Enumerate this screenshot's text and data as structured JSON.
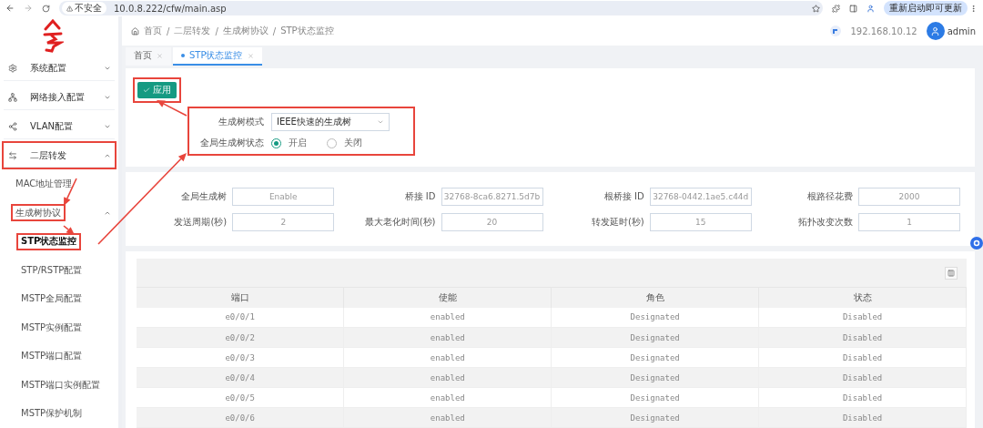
{
  "browser": {
    "security": "不安全",
    "url": "10.0.8.222/cfw/main.asp",
    "update_button": "重新启动即可更新"
  },
  "sidebar": {
    "items": [
      {
        "label": "系统配置",
        "expanded": false,
        "highlighted": false
      },
      {
        "label": "网络接入配置",
        "expanded": false,
        "highlighted": false
      },
      {
        "label": "VLAN配置",
        "expanded": false,
        "highlighted": false
      },
      {
        "label": "二层转发",
        "expanded": true,
        "highlighted": true,
        "children": [
          {
            "label": "MAC地址管理",
            "selected": false,
            "highlighted": false
          },
          {
            "label": "生成树协议",
            "selected": false,
            "highlighted": true,
            "expanded": true,
            "children": [
              {
                "label": "STP状态监控",
                "selected": true,
                "highlighted": true
              },
              {
                "label": "STP/RSTP配置",
                "selected": false,
                "highlighted": false
              },
              {
                "label": "MSTP全局配置",
                "selected": false,
                "highlighted": false
              },
              {
                "label": "MSTP实例配置",
                "selected": false,
                "highlighted": false
              },
              {
                "label": "MSTP端口配置",
                "selected": false,
                "highlighted": false
              },
              {
                "label": "MSTP端口实例配置",
                "selected": false,
                "highlighted": false
              },
              {
                "label": "MSTP保护机制",
                "selected": false,
                "highlighted": false
              }
            ]
          }
        ]
      }
    ]
  },
  "header": {
    "separator": "/",
    "breadcrumb": [
      "首页",
      "二层转发",
      "生成树协议",
      "STP状态监控"
    ],
    "ip": "192.168.10.12",
    "user": "admin"
  },
  "tabs": [
    {
      "label": "首页",
      "selected": false
    },
    {
      "label": "STP状态监控",
      "selected": true
    }
  ],
  "apply_button": {
    "label": "应用",
    "highlighted": true
  },
  "mode_form": {
    "highlighted": true,
    "mode_label": "生成树模式",
    "mode_value": "IEEE快速的生成树",
    "state_label": "全局生成树状态",
    "options": [
      {
        "label": "开启",
        "selected": true
      },
      {
        "label": "关闭",
        "selected": false
      }
    ]
  },
  "info": [
    {
      "label": "全局生成树",
      "value": "Enable"
    },
    {
      "label": "桥接 ID",
      "value": "32768-8ca6.8271.5d7b"
    },
    {
      "label": "根桥接 ID",
      "value": "32768-0442.1ae5.c44d"
    },
    {
      "label": "根路径花费",
      "value": "2000"
    },
    {
      "label": "发送周期(秒)",
      "value": "2"
    },
    {
      "label": "最大老化时间(秒)",
      "value": "20"
    },
    {
      "label": "转发延时(秒)",
      "value": "15"
    },
    {
      "label": "拓扑改变次数",
      "value": "1"
    }
  ],
  "table": {
    "columns": [
      "端口",
      "使能",
      "角色",
      "状态"
    ],
    "rows": [
      [
        "e0/0/1",
        "enabled",
        "Designated",
        "Disabled"
      ],
      [
        "e0/0/2",
        "enabled",
        "Designated",
        "Disabled"
      ],
      [
        "e0/0/3",
        "enabled",
        "Designated",
        "Disabled"
      ],
      [
        "e0/0/4",
        "enabled",
        "Designated",
        "Disabled"
      ],
      [
        "e0/0/5",
        "enabled",
        "Designated",
        "Disabled"
      ],
      [
        "e0/0/6",
        "enabled",
        "Designated",
        "Disabled"
      ]
    ]
  }
}
